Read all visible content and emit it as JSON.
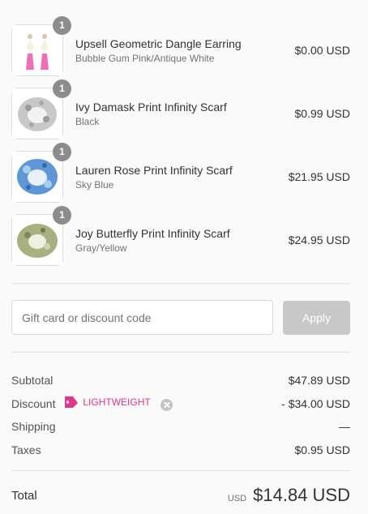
{
  "items": [
    {
      "name": "Upsell Geometric Dangle Earring",
      "variant": "Bubble Gum Pink/Antique White",
      "price": "$0.00 USD",
      "quantity": "1",
      "thumb_color": "#f06eb4"
    },
    {
      "name": "Ivy Damask Print Infinity Scarf",
      "variant": "Black",
      "price": "$0.99 USD",
      "quantity": "1",
      "thumb_color": "#b9b9b9"
    },
    {
      "name": "Lauren Rose Print Infinity Scarf",
      "variant": "Sky Blue",
      "price": "$21.95 USD",
      "quantity": "1",
      "thumb_color": "#5f97d6"
    },
    {
      "name": "Joy Butterfly Print Infinity Scarf",
      "variant": "Gray/Yellow",
      "price": "$24.95 USD",
      "quantity": "1",
      "thumb_color": "#a9b080"
    }
  ],
  "discount": {
    "placeholder": "Gift card or discount code",
    "apply_label": "Apply"
  },
  "summary": {
    "subtotal_label": "Subtotal",
    "subtotal_value": "$47.89 USD",
    "discount_label": "Discount",
    "discount_code": "LIGHTWEIGHT",
    "discount_value": "- $34.00 USD",
    "shipping_label": "Shipping",
    "shipping_value": "—",
    "taxes_label": "Taxes",
    "taxes_value": "$0.95 USD"
  },
  "total": {
    "label": "Total",
    "currency": "USD",
    "amount": "$14.84 USD"
  },
  "colors": {
    "accent": "#e0368c",
    "badge": "#8c8c8c",
    "apply_disabled": "#c8c8c8"
  }
}
